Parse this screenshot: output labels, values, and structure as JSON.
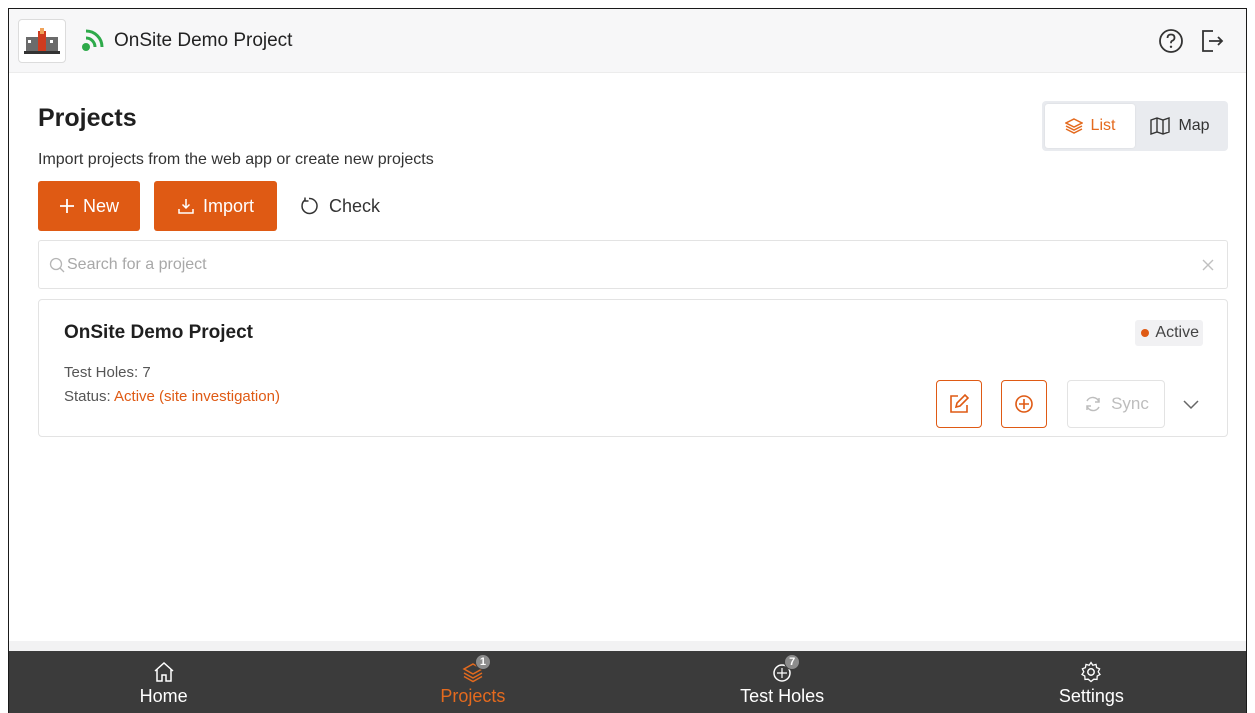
{
  "header": {
    "title": "OnSite Demo Project",
    "logo_icon": "site-logo-icon",
    "signal_icon": "gps-signal-icon",
    "help_icon": "help-icon",
    "logout_icon": "logout-icon"
  },
  "page": {
    "title": "Projects",
    "subtitle": "Import projects from the web app or create new projects"
  },
  "view_toggle": {
    "list_label": "List",
    "map_label": "Map",
    "selected": "List"
  },
  "actions": {
    "new_label": "New",
    "import_label": "Import",
    "check_label": "Check"
  },
  "search": {
    "placeholder": "Search for a project",
    "value": ""
  },
  "projects": [
    {
      "name": "OnSite Demo Project",
      "badge": "Active",
      "test_holes_text": "Test Holes: 7",
      "status_label": "Status:",
      "status_value": "Active (site investigation)",
      "sync_label": "Sync"
    }
  ],
  "bottom_nav": {
    "items": [
      {
        "label": "Home",
        "icon": "home-icon",
        "badge": ""
      },
      {
        "label": "Projects",
        "icon": "layers-icon",
        "badge": "1"
      },
      {
        "label": "Test Holes",
        "icon": "test-hole-icon",
        "badge": "7"
      },
      {
        "label": "Settings",
        "icon": "gear-icon",
        "badge": ""
      }
    ],
    "active": "Projects"
  },
  "colors": {
    "accent": "#df5a14",
    "nav_background": "#3b3b3b",
    "signal_green": "#2eaa4a"
  }
}
